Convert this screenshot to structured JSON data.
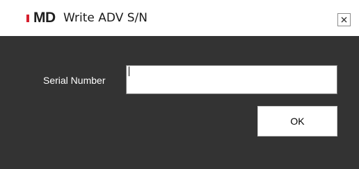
{
  "window": {
    "logo_text": "MD",
    "title": "Write ADV S/N",
    "close_icon": "close-icon",
    "accent_color": "#d6202e"
  },
  "form": {
    "serial_label": "Serial Number",
    "serial_value": "",
    "ok_label": "OK"
  }
}
